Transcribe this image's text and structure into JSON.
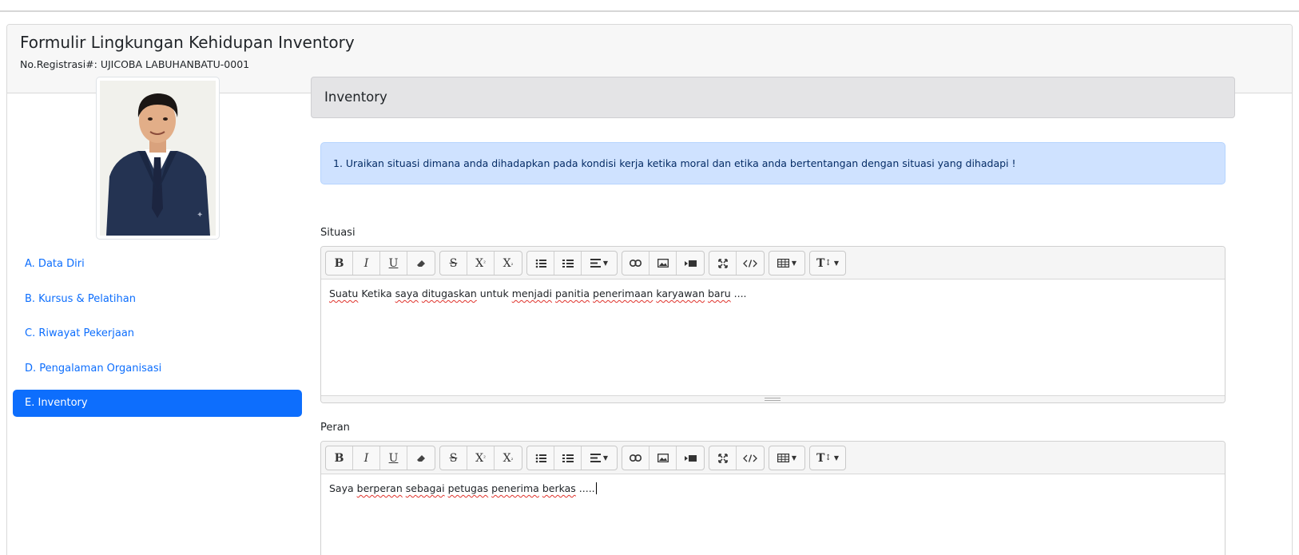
{
  "header": {
    "title": "Formulir Lingkungan Kehidupan Inventory",
    "registration": "No.Registrasi#: UJICOBA LABUHANBATU-0001"
  },
  "sidebar": {
    "items": [
      {
        "label": "A. Data Diri",
        "active": false
      },
      {
        "label": "B. Kursus & Pelatihan",
        "active": false
      },
      {
        "label": "C. Riwayat Pekerjaan",
        "active": false
      },
      {
        "label": "D. Pengalaman Organisasi",
        "active": false
      },
      {
        "label": "E. Inventory",
        "active": true
      }
    ]
  },
  "main": {
    "section_title": "Inventory",
    "question": "1. Uraikan situasi dimana anda dihadapkan pada kondisi kerja ketika moral dan etika anda bertentangan dengan situasi yang dihadapi !",
    "fields": [
      {
        "label": "Situasi",
        "words": [
          "Suatu",
          "Ketika",
          "saya",
          "ditugaskan",
          "untuk",
          "menjadi",
          "panitia",
          "penerimaan",
          "karyawan",
          "baru",
          "...."
        ],
        "misspelled": [
          0,
          2,
          3,
          5,
          6,
          7,
          8,
          9
        ]
      },
      {
        "label": "Peran",
        "words": [
          "Saya",
          "berperan",
          "sebagai",
          "petugas",
          "penerima",
          "berkas",
          "....."
        ],
        "misspelled": [
          1,
          2,
          3,
          4,
          5
        ]
      }
    ]
  },
  "toolbar": {
    "bold": "B",
    "italic": "I",
    "underline": "U",
    "strike": "S",
    "superscript": "X",
    "subscript": "X",
    "font_size": "T"
  },
  "colors": {
    "accent": "#0d6efd",
    "alert_bg": "#cfe2ff",
    "section_bg": "#e4e4e6"
  }
}
